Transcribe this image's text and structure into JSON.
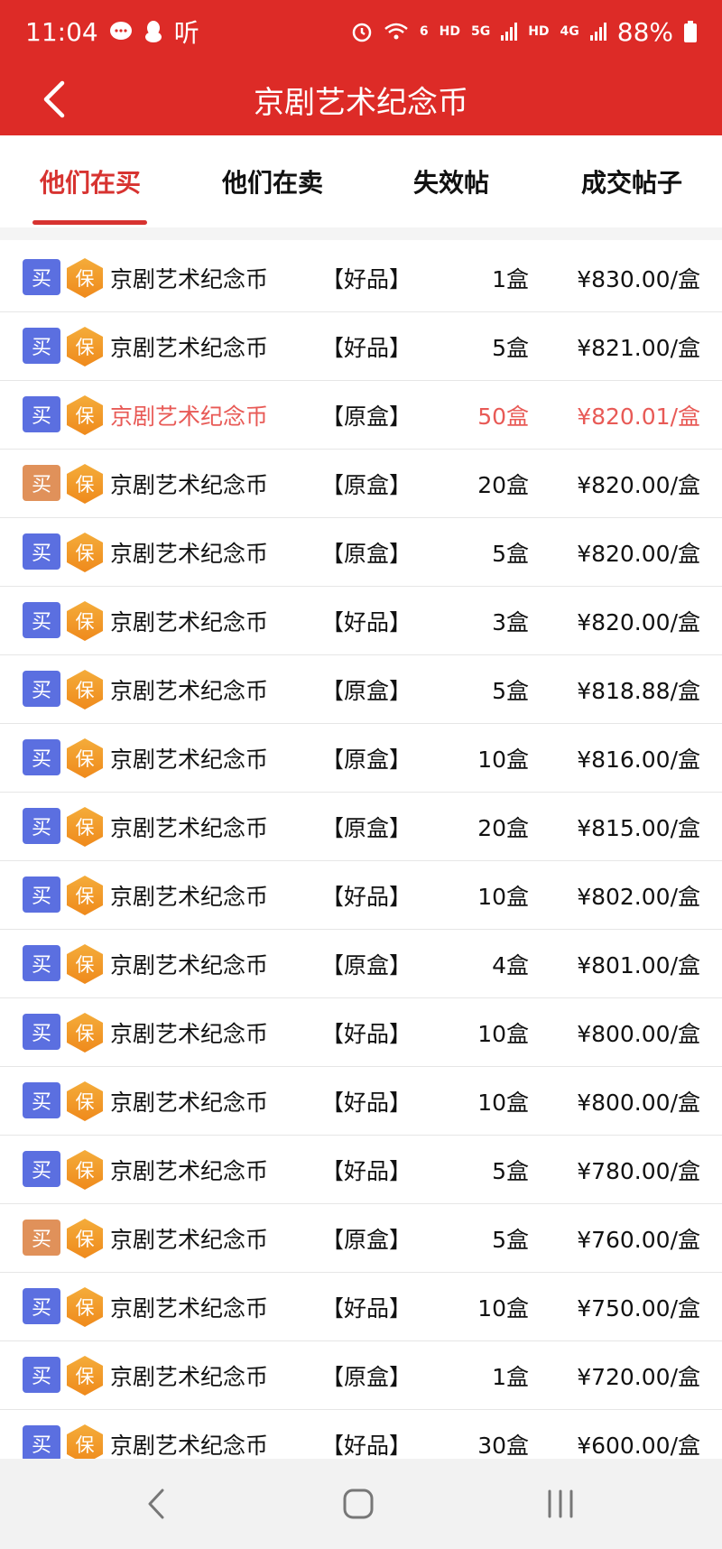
{
  "status_bar": {
    "time": "11:04",
    "listen_text": "听",
    "wifi_label": "6",
    "hd1": "HD",
    "net1": "5G",
    "hd2": "HD",
    "net2": "4G",
    "battery": "88%"
  },
  "header": {
    "title": "京剧艺术纪念币",
    "background_color": "#dd2b27"
  },
  "tabs": [
    {
      "label": "他们在买",
      "active": true
    },
    {
      "label": "他们在卖",
      "active": false
    },
    {
      "label": "失效帖",
      "active": false
    },
    {
      "label": "成交帖子",
      "active": false
    }
  ],
  "badges": {
    "buy": "买",
    "guarantee": "保",
    "buy_color_blue": "#5b6fe0",
    "buy_color_orange": "#e0915a",
    "highlight_color": "#e85a56"
  },
  "listings": [
    {
      "name": "京剧艺术纪念币",
      "condition": "【好品】",
      "quantity": "1盒",
      "price": "¥830.00/盒",
      "badge_style": "blue",
      "highlight": false
    },
    {
      "name": "京剧艺术纪念币",
      "condition": "【好品】",
      "quantity": "5盒",
      "price": "¥821.00/盒",
      "badge_style": "blue",
      "highlight": false
    },
    {
      "name": "京剧艺术纪念币",
      "condition": "【原盒】",
      "quantity": "50盒",
      "price": "¥820.01/盒",
      "badge_style": "blue",
      "highlight": true
    },
    {
      "name": "京剧艺术纪念币",
      "condition": "【原盒】",
      "quantity": "20盒",
      "price": "¥820.00/盒",
      "badge_style": "orange",
      "highlight": false
    },
    {
      "name": "京剧艺术纪念币",
      "condition": "【原盒】",
      "quantity": "5盒",
      "price": "¥820.00/盒",
      "badge_style": "blue",
      "highlight": false
    },
    {
      "name": "京剧艺术纪念币",
      "condition": "【好品】",
      "quantity": "3盒",
      "price": "¥820.00/盒",
      "badge_style": "blue",
      "highlight": false
    },
    {
      "name": "京剧艺术纪念币",
      "condition": "【原盒】",
      "quantity": "5盒",
      "price": "¥818.88/盒",
      "badge_style": "blue",
      "highlight": false
    },
    {
      "name": "京剧艺术纪念币",
      "condition": "【原盒】",
      "quantity": "10盒",
      "price": "¥816.00/盒",
      "badge_style": "blue",
      "highlight": false
    },
    {
      "name": "京剧艺术纪念币",
      "condition": "【原盒】",
      "quantity": "20盒",
      "price": "¥815.00/盒",
      "badge_style": "blue",
      "highlight": false
    },
    {
      "name": "京剧艺术纪念币",
      "condition": "【好品】",
      "quantity": "10盒",
      "price": "¥802.00/盒",
      "badge_style": "blue",
      "highlight": false
    },
    {
      "name": "京剧艺术纪念币",
      "condition": "【原盒】",
      "quantity": "4盒",
      "price": "¥801.00/盒",
      "badge_style": "blue",
      "highlight": false
    },
    {
      "name": "京剧艺术纪念币",
      "condition": "【好品】",
      "quantity": "10盒",
      "price": "¥800.00/盒",
      "badge_style": "blue",
      "highlight": false
    },
    {
      "name": "京剧艺术纪念币",
      "condition": "【好品】",
      "quantity": "10盒",
      "price": "¥800.00/盒",
      "badge_style": "blue",
      "highlight": false
    },
    {
      "name": "京剧艺术纪念币",
      "condition": "【好品】",
      "quantity": "5盒",
      "price": "¥780.00/盒",
      "badge_style": "blue",
      "highlight": false
    },
    {
      "name": "京剧艺术纪念币",
      "condition": "【原盒】",
      "quantity": "5盒",
      "price": "¥760.00/盒",
      "badge_style": "orange",
      "highlight": false
    },
    {
      "name": "京剧艺术纪念币",
      "condition": "【好品】",
      "quantity": "10盒",
      "price": "¥750.00/盒",
      "badge_style": "blue",
      "highlight": false
    },
    {
      "name": "京剧艺术纪念币",
      "condition": "【原盒】",
      "quantity": "1盒",
      "price": "¥720.00/盒",
      "badge_style": "blue",
      "highlight": false
    },
    {
      "name": "京剧艺术纪念币",
      "condition": "【好品】",
      "quantity": "30盒",
      "price": "¥600.00/盒",
      "badge_style": "blue",
      "highlight": false
    }
  ],
  "nav": {
    "icons": [
      "back-icon",
      "home-icon",
      "recents-icon"
    ]
  }
}
